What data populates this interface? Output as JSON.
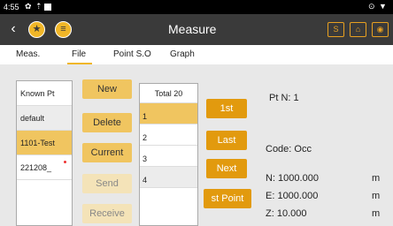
{
  "status": {
    "time": "4:55"
  },
  "appbar": {
    "title": "Measure",
    "s_label": "S"
  },
  "tabs": [
    "Meas.",
    "File",
    "Point S.O",
    "Graph"
  ],
  "files": [
    {
      "name": "Known Pt"
    },
    {
      "name": "default"
    },
    {
      "name": "1101-Test"
    },
    {
      "name": "221208_"
    }
  ],
  "actions": {
    "new": "New",
    "delete": "Delete",
    "current": "Current",
    "send": "Send",
    "receive": "Receive"
  },
  "points": {
    "total_label": "Total 20",
    "rows": [
      "1",
      "2",
      "3",
      "4"
    ]
  },
  "nav": {
    "first": "1st",
    "last": "Last",
    "next": "Next",
    "last_point": "st Point"
  },
  "info": {
    "pt_n": "Pt N: 1",
    "code": "Code: Occ",
    "n": "N: 1000.000",
    "e": "E: 1000.000",
    "z": "Z: 10.000",
    "unit": "m"
  },
  "colors": {
    "accent": "#f0b628",
    "nav_button": "#e29a0e",
    "toolbar": "#3a3a3a"
  }
}
